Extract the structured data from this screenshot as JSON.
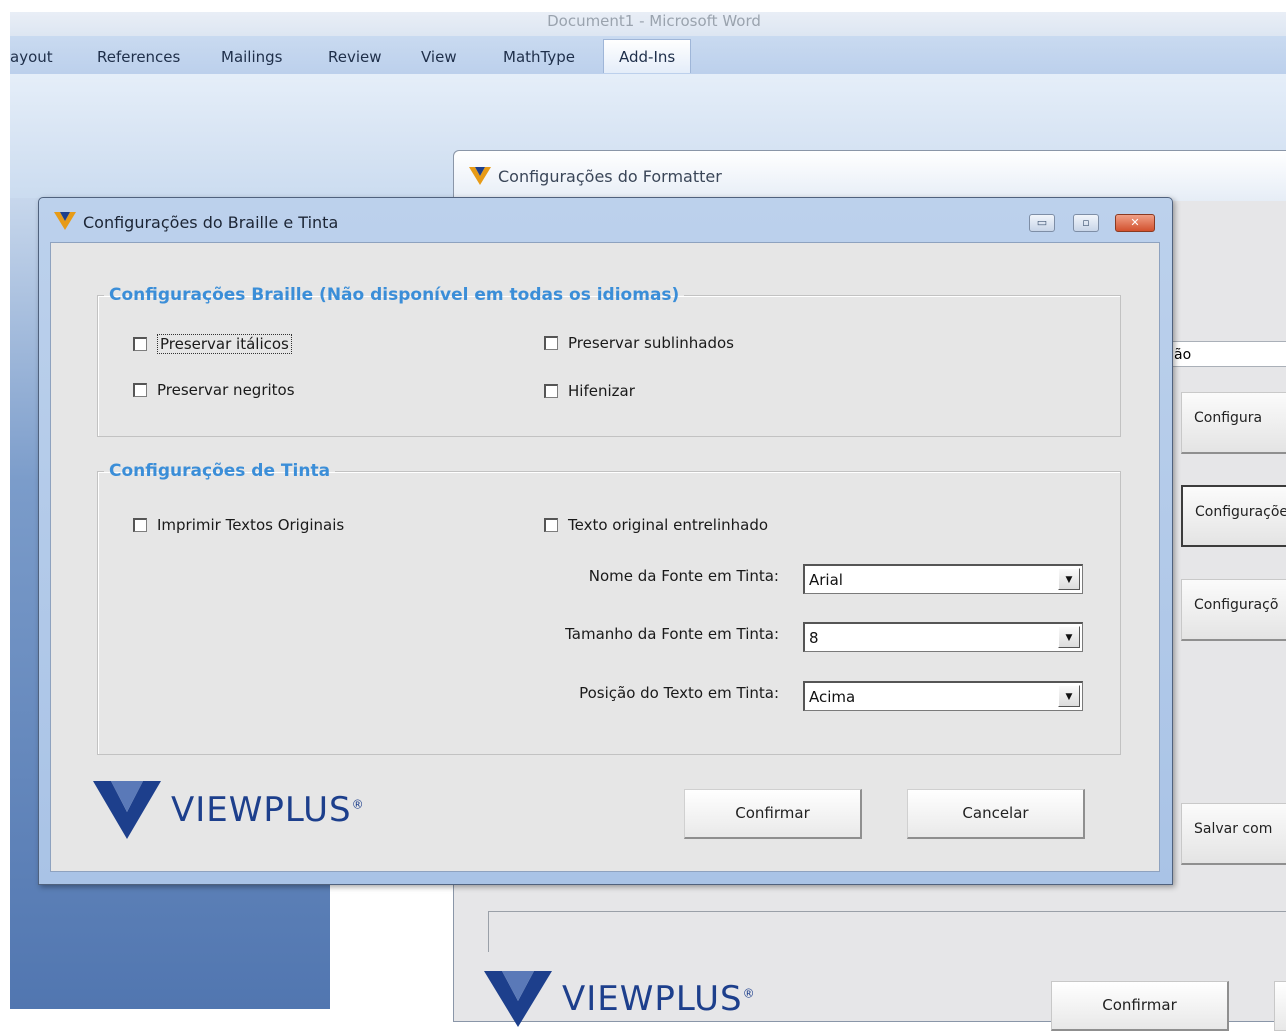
{
  "word": {
    "title": "Document1 - Microsoft Word",
    "tabs": [
      "ayout",
      "References",
      "Mailings",
      "Review",
      "View",
      "MathType",
      "Add-Ins"
    ],
    "active_tab": "Add-Ins"
  },
  "formatter": {
    "title": "Configurações do Formatter",
    "field_value": "ão",
    "side_buttons": [
      "Configura",
      "Configuraçõe",
      "Configuraçõ",
      "Salvar com"
    ],
    "logo_text": "VIEWPLUS",
    "confirm_label": "Confirmar"
  },
  "dialog": {
    "title": "Configurações do Braille e Tinta",
    "window_buttons": {
      "minimize": "▭",
      "maximize": "▫",
      "close": "✕"
    },
    "braille_group": {
      "legend": "Configurações Braille (Não disponível em todas os idiomas)",
      "checkboxes": [
        {
          "label": "Preservar itálicos",
          "checked": false
        },
        {
          "label": "Preservar sublinhados",
          "checked": false
        },
        {
          "label": "Preservar negritos",
          "checked": false
        },
        {
          "label": "Hifenizar",
          "checked": false
        }
      ]
    },
    "ink_group": {
      "legend": "Configurações de Tinta",
      "checkboxes": [
        {
          "label": "Imprimir Textos Originais",
          "checked": false
        },
        {
          "label": "Texto original entrelinhado",
          "checked": false
        }
      ],
      "fields": [
        {
          "label": "Nome da Fonte em Tinta:",
          "value": "Arial"
        },
        {
          "label": "Tamanho da Fonte em Tinta:",
          "value": "8"
        },
        {
          "label": "Posição do Texto em Tinta:",
          "value": "Acima"
        }
      ]
    },
    "logo_text": "VIEWPLUS",
    "logo_mark": "®",
    "buttons": {
      "confirm": "Confirmar",
      "cancel": "Cancelar"
    },
    "colors": {
      "legend": "#3b8ed8",
      "logo": "#1d3f8c"
    }
  }
}
